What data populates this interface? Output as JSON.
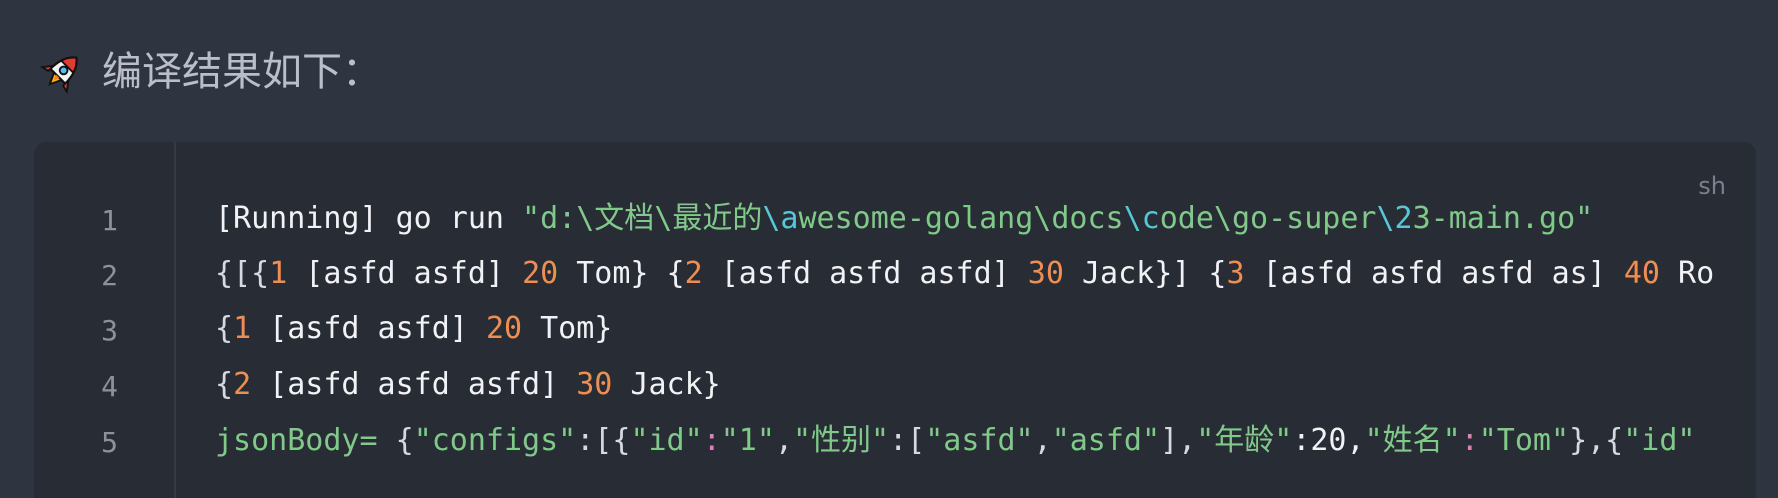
{
  "heading": {
    "icon": "rocket-icon",
    "text": "编译结果如下："
  },
  "code_block": {
    "language": "sh",
    "line_numbers": [
      "1",
      "2",
      "3",
      "4",
      "5"
    ],
    "lines": [
      {
        "tokens": [
          {
            "text": "[Running] go run ",
            "color": "white"
          },
          {
            "text": "\"d:\\文档\\最近的",
            "color": "green"
          },
          {
            "text": "\\a",
            "color": "cyan"
          },
          {
            "text": "wesome-golang\\docs",
            "color": "green"
          },
          {
            "text": "\\c",
            "color": "cyan"
          },
          {
            "text": "ode\\go-super",
            "color": "green"
          },
          {
            "text": "\\2",
            "color": "cyan"
          },
          {
            "text": "3-main.go\"",
            "color": "green"
          }
        ]
      },
      {
        "tokens": [
          {
            "text": "{[{",
            "color": "punc"
          },
          {
            "text": "1",
            "color": "orange"
          },
          {
            "text": " [asfd asfd] ",
            "color": "white"
          },
          {
            "text": "20",
            "color": "orange"
          },
          {
            "text": " Tom} {",
            "color": "white"
          },
          {
            "text": "2",
            "color": "orange"
          },
          {
            "text": " [asfd asfd asfd] ",
            "color": "white"
          },
          {
            "text": "30",
            "color": "orange"
          },
          {
            "text": " Jack}] {",
            "color": "white"
          },
          {
            "text": "3",
            "color": "orange"
          },
          {
            "text": " [asfd asfd asfd as] ",
            "color": "white"
          },
          {
            "text": "40",
            "color": "orange"
          },
          {
            "text": " Ro",
            "color": "white"
          }
        ]
      },
      {
        "tokens": [
          {
            "text": "{",
            "color": "punc"
          },
          {
            "text": "1",
            "color": "orange"
          },
          {
            "text": " [asfd asfd] ",
            "color": "white"
          },
          {
            "text": "20",
            "color": "orange"
          },
          {
            "text": " Tom}",
            "color": "white"
          }
        ]
      },
      {
        "tokens": [
          {
            "text": "{",
            "color": "punc"
          },
          {
            "text": "2",
            "color": "orange"
          },
          {
            "text": " [asfd asfd asfd] ",
            "color": "white"
          },
          {
            "text": "30",
            "color": "orange"
          },
          {
            "text": " Jack}",
            "color": "white"
          }
        ]
      },
      {
        "tokens": [
          {
            "text": "jsonBody= ",
            "color": "green"
          },
          {
            "text": "{",
            "color": "punc"
          },
          {
            "text": "\"configs\"",
            "color": "green"
          },
          {
            "text": ":[{",
            "color": "punc"
          },
          {
            "text": "\"id\"",
            "color": "green"
          },
          {
            "text": ":",
            "color": "pink"
          },
          {
            "text": "\"1\"",
            "color": "green"
          },
          {
            "text": ",",
            "color": "punc"
          },
          {
            "text": "\"性别\"",
            "color": "green"
          },
          {
            "text": ":[",
            "color": "punc"
          },
          {
            "text": "\"asfd\"",
            "color": "green"
          },
          {
            "text": ",",
            "color": "punc"
          },
          {
            "text": "\"asfd\"",
            "color": "green"
          },
          {
            "text": "],",
            "color": "punc"
          },
          {
            "text": "\"年龄\"",
            "color": "green"
          },
          {
            "text": ":20,",
            "color": "white"
          },
          {
            "text": "\"姓名\"",
            "color": "green"
          },
          {
            "text": ":",
            "color": "pink"
          },
          {
            "text": "\"Tom\"",
            "color": "green"
          },
          {
            "text": "},{",
            "color": "punc"
          },
          {
            "text": "\"id\"",
            "color": "green"
          }
        ]
      }
    ]
  },
  "colors": {
    "page_background": "#2f3441",
    "code_background": "#282c34",
    "white": "#f0f2f5",
    "green": "#81c98a",
    "cyan": "#56c7d6",
    "orange": "#ef8e52",
    "pink": "#e17cbf"
  }
}
